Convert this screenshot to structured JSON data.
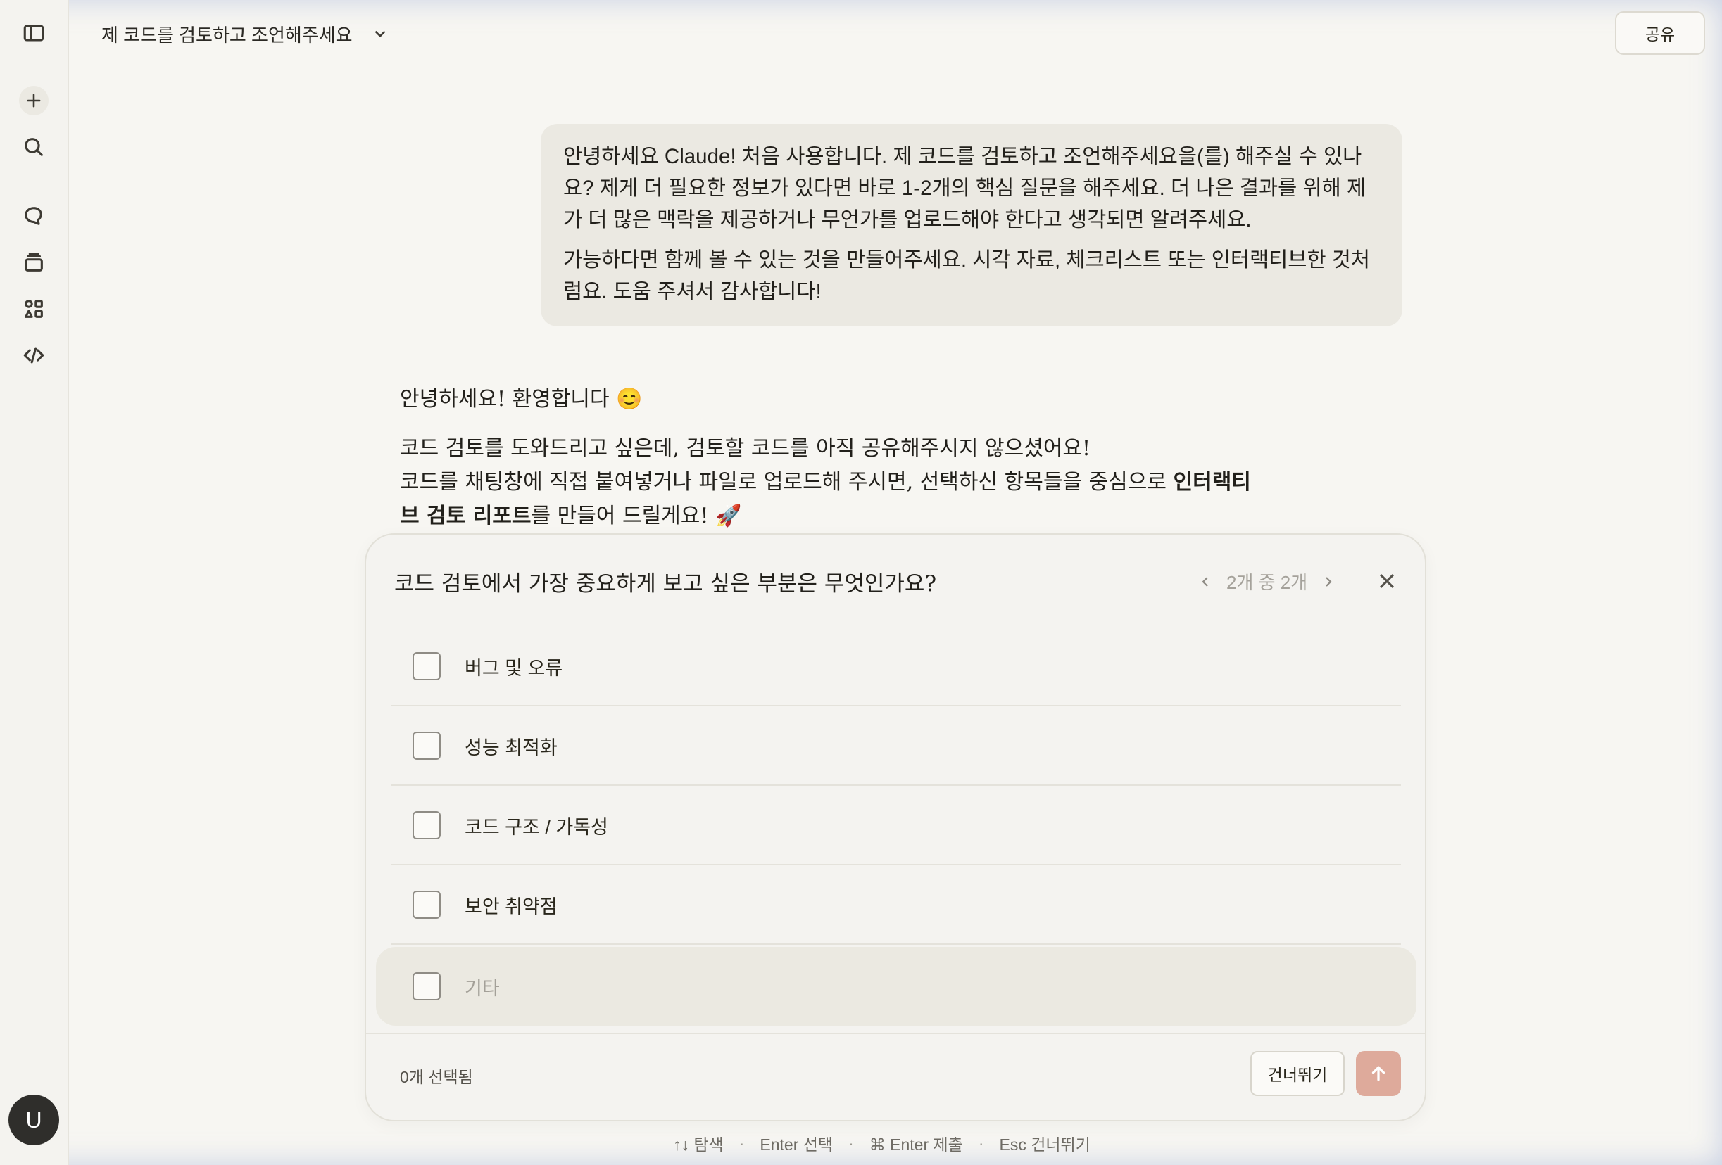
{
  "header": {
    "title": "제 코드를 검토하고 조언해주세요",
    "share_label": "공유"
  },
  "sidebar": {
    "icons": [
      "sidebar-toggle-icon",
      "plus-icon",
      "search-icon",
      "chat-bubble-icon",
      "projects-stack-icon",
      "artifacts-icon",
      "code-icon"
    ],
    "avatar_letter": "U"
  },
  "user_message": {
    "paragraph1_lines": [
      "안녕하세요 Claude! 처음 사용합니다. 제 코드를 검토하고 조언해주세요을(를) 해주실 수 있나",
      "요? 제게 더 필요한 정보가 있다면 바로 1-2개의 핵심 질문을 해주세요. 더 나은 결과를 위해 제",
      "가 더 많은 맥락을 제공하거나 무언가를 업로드해야 한다고 생각되면 알려주세요."
    ],
    "paragraph2_lines": [
      "가능하다면 함께 볼 수 있는 것을 만들어주세요. 시각 자료, 체크리스트 또는 인터랙티브한 것처",
      "럼요. 도움 주셔서 감사합니다!"
    ]
  },
  "assistant_message": {
    "greeting": "안녕하세요! 환영합니다 😊",
    "line1": "코드 검토를 도와드리고 싶은데, 검토할 코드를 아직 공유해주시지 않으셨어요!",
    "line2_prefix": "코드를 채팅창에 직접 붙여넣거나 파일로 업로드해 주시면, 선택하신 항목들을 중심으로 ",
    "line2_bold": "인터랙티",
    "line3_bold": "브 검토 리포트",
    "line3_suffix": "를 만들어 드릴게요! 🚀"
  },
  "question_card": {
    "question": "코드 검토에서 가장 중요하게 보고 싶은 부분은 무엇인가요?",
    "pager": "2개 중 2개",
    "options": [
      "버그 및 오류",
      "성능 최적화",
      "코드 구조 / 가독성",
      "보안 취약점",
      "기타"
    ],
    "selected_count": "0개 선택됨",
    "skip_label": "건너뛰기"
  },
  "hints": {
    "navigate": "↑↓ 탐색",
    "select": "Enter 선택",
    "submit": "⌘ Enter 제출",
    "skip": "Esc 건너뛰기"
  }
}
